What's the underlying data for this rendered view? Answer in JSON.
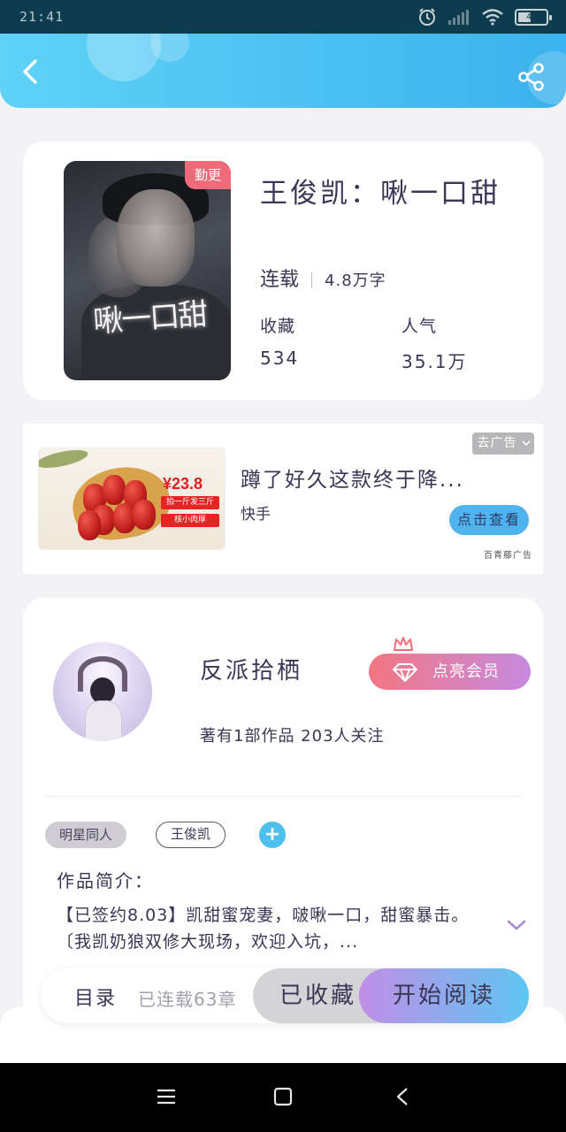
{
  "status_bar": {
    "time": "21:41",
    "battery_level": "42",
    "icons": [
      "alarm-icon",
      "signal-icon",
      "wifi-icon",
      "battery-icon"
    ]
  },
  "header": {
    "back_icon": "chevron-left-icon",
    "share_icon": "share-icon"
  },
  "book": {
    "cover_badge": "勤更",
    "cover_title": "啾一口甜",
    "title": "王俊凯：啾一口甜",
    "status": "连载",
    "word_count": "4.8万字",
    "stats": [
      {
        "label": "收藏",
        "value": "534"
      },
      {
        "label": "人气",
        "value": "35.1万"
      }
    ]
  },
  "ad": {
    "image_price": "¥23.8",
    "image_tag1": "拍一斤发三斤",
    "image_tag2": "核小肉厚",
    "title": "蹲了好久这款终于降...",
    "source": "快手",
    "close_label": "去广告",
    "cta_label": "点击查看",
    "provider": "百青藤广告"
  },
  "author": {
    "name": "反派拾栖",
    "stats": "著有1部作品 203人关注",
    "vip_label": "点亮会员",
    "tags": [
      "明星同人",
      "王俊凯"
    ],
    "intro_label": "作品简介：",
    "intro_text": "【已签约8.03】凯甜蜜宠妻，啵啾一口，甜蜜暴击。〔我凯奶狼双修大现场，欢迎入坑，..."
  },
  "action_bar": {
    "toc_label": "目录",
    "chapter_status": "已连载63章",
    "favorite_label": "已收藏",
    "read_label": "开始阅读"
  },
  "colors": {
    "header_gradient_start": "#5fd2f6",
    "header_gradient_end": "#3cb2ee",
    "update_badge": "#f06b7a",
    "vip_gradient_start": "#f37682",
    "vip_gradient_end": "#c68ae0",
    "read_gradient_start": "#c08ee6",
    "read_gradient_end": "#5ec6f2"
  },
  "nav_bar": {
    "icons": [
      "menu-icon",
      "home-square-icon",
      "back-triangle-icon"
    ]
  }
}
